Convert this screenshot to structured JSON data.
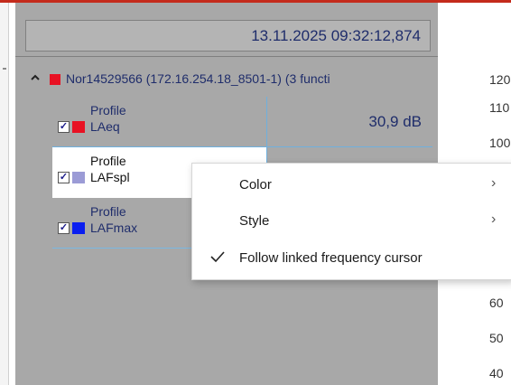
{
  "timestamp": "13.11.2025 09:32:12,874",
  "device": {
    "label": "Nor14529566 (172.16.254.18_8501-1) (3 functi",
    "color": "#e81123",
    "expanded": true
  },
  "functions": [
    {
      "line1": "Profile",
      "line2": "LAeq",
      "value": "30,9 dB",
      "checked": true,
      "color": "#e81123"
    },
    {
      "line1": "Profile",
      "line2": "LAFspl",
      "value": "",
      "checked": true,
      "color": "#9b9bd6"
    },
    {
      "line1": "Profile",
      "line2": "LAFmax",
      "value": "",
      "checked": true,
      "color": "#0a1ef0"
    }
  ],
  "y_axis_labels": [
    "120",
    "110",
    "100",
    "60",
    "50",
    "40"
  ],
  "context_menu": {
    "items": [
      {
        "label": "Color",
        "has_submenu": true,
        "checked": false
      },
      {
        "label": "Style",
        "has_submenu": true,
        "checked": false
      },
      {
        "label": "Follow linked frequency cursor",
        "has_submenu": false,
        "checked": true
      }
    ]
  },
  "glyphs": {
    "check": "✓",
    "chevron_up": "^",
    "submenu_arrow": "›"
  }
}
